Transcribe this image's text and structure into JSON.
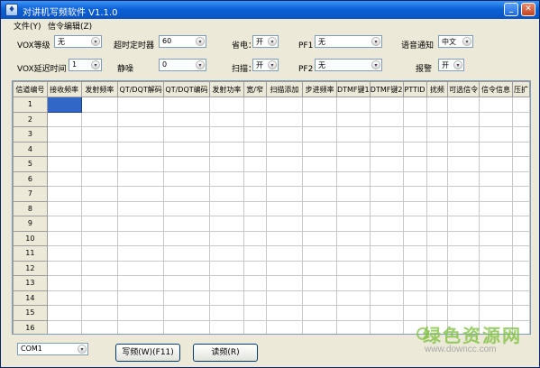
{
  "window": {
    "title": "对讲机写频软件 V1.1.0",
    "icon_glyph": "♦",
    "minimize_glyph": "_",
    "close_glyph": "✕"
  },
  "menu": {
    "file": "文件(Y)",
    "signal_edit": "信令编辑(Z)"
  },
  "form": {
    "vox_level": {
      "label": "VOX等级",
      "value": "无"
    },
    "timeout_timer": {
      "label": "超时定时器",
      "value": "60"
    },
    "power_save": {
      "label": "省电：",
      "value": "开"
    },
    "pf1": {
      "label": "PF1：",
      "value": "无"
    },
    "voice_prompt": {
      "label": "语音通知",
      "value": "中文"
    },
    "vox_delay": {
      "label": "VOX延迟时间",
      "value": "1"
    },
    "squelch": {
      "label": "静噪",
      "value": "0"
    },
    "scan": {
      "label": "扫描：",
      "value": "开"
    },
    "pf2": {
      "label": "PF2：",
      "value": "无"
    },
    "alarm": {
      "label": "报警",
      "value": "开"
    }
  },
  "grid": {
    "columns": [
      "信道编号",
      "接收频率",
      "发射频率",
      "QT/DQT解码",
      "QT/DQT编码",
      "发射功率",
      "宽/窄",
      "扫描添加",
      "步进频率",
      "DTMF键1",
      "DTMF键2",
      "PTTID",
      "扰频",
      "可选信令",
      "信令信息",
      "压扩"
    ],
    "rows": [
      "1",
      "2",
      "3",
      "4",
      "5",
      "6",
      "7",
      "8",
      "9",
      "10",
      "11",
      "12",
      "13",
      "14",
      "15",
      "16"
    ]
  },
  "bottom": {
    "port": "COM1",
    "write_button": "写频(W)(F11)",
    "read_button": "读频(R)"
  },
  "watermark": {
    "brand": "绿色资源网",
    "url": "www.downcc.com"
  },
  "colors": {
    "title_bar": "#0b61d7",
    "selected_cell": "#3168c7",
    "watermark_green": "#7bbf3a"
  }
}
